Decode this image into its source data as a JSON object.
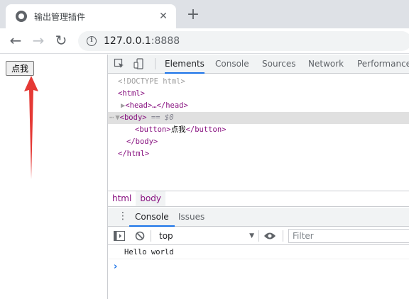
{
  "browser": {
    "tab_title": "输出管理插件",
    "close_glyph": "✕",
    "newtab_glyph": "+",
    "url_host": "127.0.0.1",
    "url_port": ":8888",
    "back_glyph": "←",
    "forward_glyph": "→",
    "reload_glyph": "↻"
  },
  "page": {
    "button_label": "点我",
    "arrow_color": "#e53935"
  },
  "devtools": {
    "tabs": [
      "Elements",
      "Console",
      "Sources",
      "Network",
      "Performance"
    ],
    "active_tab": "Elements",
    "dom": {
      "doctype": "<!DOCTYPE html>",
      "html_open": "<html>",
      "head": "<head>…</head>",
      "body_open": "<body>",
      "body_marker": "== $0",
      "button_open": "<button>",
      "button_text": "点我",
      "button_close": "</button>",
      "body_close": "</body>",
      "html_close": "</html>"
    },
    "breadcrumbs": [
      "html",
      "body"
    ],
    "drawer_tabs": [
      "Console",
      "Issues"
    ],
    "context": "top",
    "filter_placeholder": "Filter",
    "console_message": "Hello world",
    "prompt_glyph": "›",
    "accent_color": "#1a73e8"
  }
}
